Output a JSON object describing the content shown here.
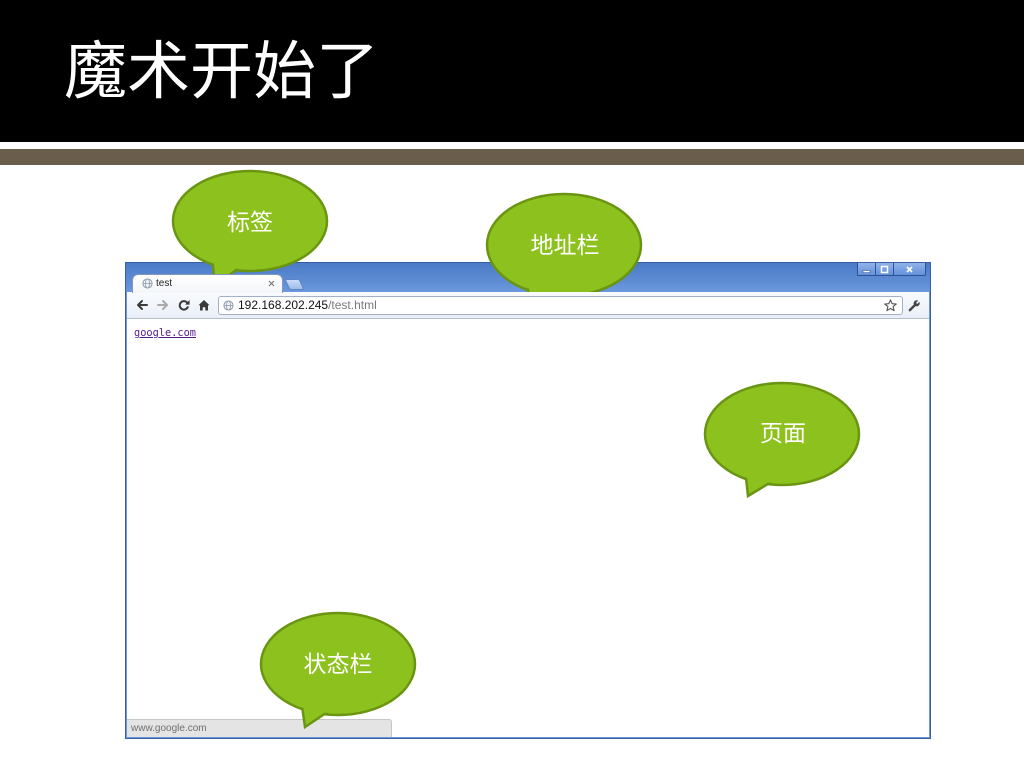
{
  "slide": {
    "title": "魔术开始了"
  },
  "callouts": {
    "tab": "标签",
    "address_bar": "地址栏",
    "page": "页面",
    "status_bar": "状态栏"
  },
  "browser": {
    "tab": {
      "title": "test",
      "favicon": "globe-icon",
      "close_icon": "close-icon"
    },
    "new_tab_icon": "new-tab-icon",
    "window_controls": [
      "minimize-icon",
      "maximize-icon",
      "close-icon"
    ],
    "toolbar_icons": {
      "back": "back-arrow-icon",
      "forward": "forward-arrow-icon",
      "reload": "reload-icon",
      "home": "home-icon",
      "bookmark": "star-icon",
      "settings": "wrench-icon"
    },
    "address": {
      "icon": "globe-icon",
      "host": "192.168.202.245",
      "path": "/test.html"
    },
    "page": {
      "link_text": "google.com"
    },
    "status_bar": {
      "text": "www.google.com"
    }
  },
  "colors": {
    "header_background": "#000000",
    "title_text": "#ffffff",
    "stripe": "#6b5d4c",
    "callout_fill": "#8dc11d",
    "callout_border": "#6a9512",
    "callout_text": "#ffffff",
    "browser_frame": "#6b97dc",
    "visited_link": "#551a8b"
  }
}
